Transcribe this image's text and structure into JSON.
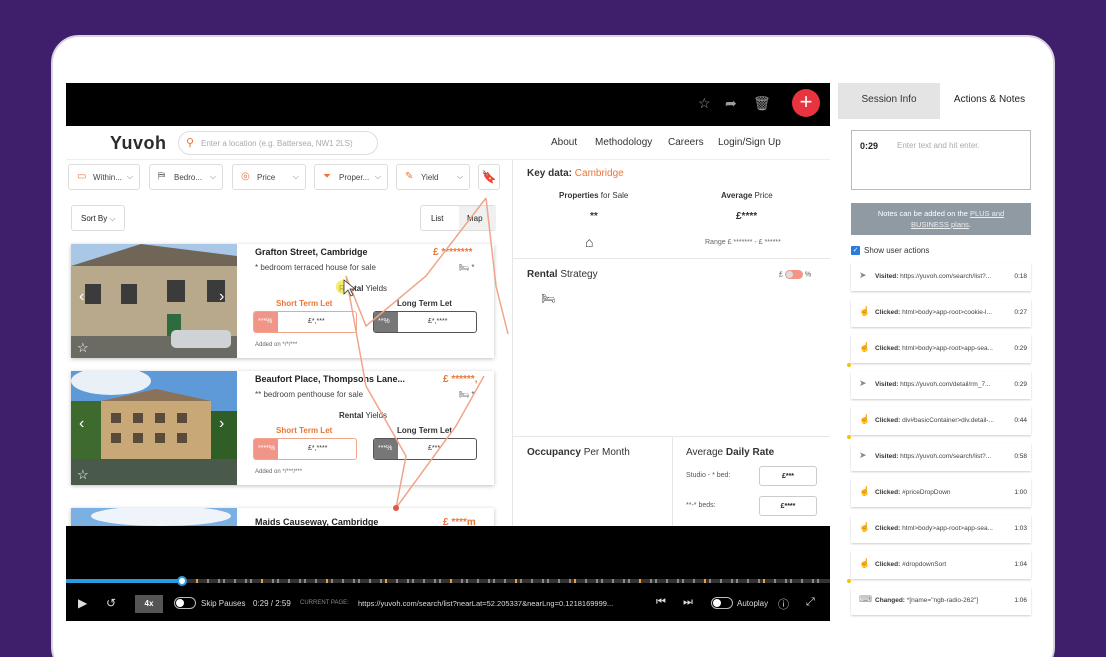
{
  "player": {
    "speed": "4x",
    "skip_pauses_label": "Skip Pauses",
    "time": "0:29 / 2:59",
    "current_page_label": "CURRENT PAGE:",
    "current_page_url": "https://yuvoh.com/search/list?nearLat=52.205337&nearLng=0.1218169999...",
    "autoplay_label": "Autoplay",
    "progress_fraction": 0.152
  },
  "site": {
    "logo": "Yuvoh",
    "search_placeholder": "Enter a location (e.g. Battersea, NW1 2LS)",
    "nav": [
      "About",
      "Methodology",
      "Careers",
      "Login/Sign Up"
    ],
    "filters": [
      "Within...",
      "Bedro...",
      "Price",
      "Proper...",
      "Yield"
    ],
    "sort_label": "Sort By",
    "view_list": "List",
    "view_map": "Map",
    "listings": [
      {
        "title": "Grafton Street, Cambridge",
        "price": "£ ********",
        "beds": "*",
        "desc": "* bedroom terraced house for sale",
        "yields_a": "Rental",
        "yields_b": " Yields",
        "short_label": "Short Term Let",
        "long_label": "Long Term Let",
        "short_pct": "***%",
        "short_val": "£*,***",
        "long_pct": "**%",
        "long_val": "£*,****",
        "added": "Added on */*/***"
      },
      {
        "title": "Beaufort Place, Thompsons Lane...",
        "price": "£ ******,",
        "beds": "*",
        "desc": "** bedroom penthouse for sale",
        "yields_a": "Rental",
        "yields_b": " Yields",
        "short_label": "Short Term Let",
        "long_label": "Long Term Let",
        "short_pct": "****%",
        "short_val": "£*,****",
        "long_pct": "***%",
        "long_val": "£***",
        "added": "Added on */***/***"
      },
      {
        "title": "Maids Causeway, Cambridge",
        "price": "£ ****m"
      }
    ],
    "keydata": {
      "label": "Key data:",
      "city": "Cambridge",
      "props_a": "Properties",
      "props_b": " for Sale",
      "props_val": "**",
      "avg_a": "Average",
      "avg_b": " Price",
      "avg_val": "£****",
      "range": "Range  £ ******* - £ ******"
    },
    "rental": {
      "title_a": "Rental",
      "title_b": " Strategy",
      "cur_left": "£",
      "cur_right": "%"
    },
    "occupancy": {
      "title_a": "Occupancy",
      "title_b": " Per Month"
    },
    "adr": {
      "title_a": "Average ",
      "title_b": "Daily Rate",
      "rows": [
        {
          "label": "Studio - * bed:",
          "value": "£***"
        },
        {
          "label": "**-* beds:",
          "value": "£****"
        }
      ]
    }
  },
  "panel": {
    "tab_session": "Session Info",
    "tab_actions": "Actions & Notes",
    "note_time": "0:29",
    "note_placeholder": "Enter text and hit enter.",
    "locked_text_a": "Notes can be added on the ",
    "locked_link": "PLUS and BUSINESS plans",
    "locked_text_b": ".",
    "show_user_actions": "Show user actions",
    "actions": [
      {
        "icon": "navigate-icon",
        "kind": "Visited:",
        "text": "https://yuvoh.com/search/list?...",
        "time": "0:18"
      },
      {
        "icon": "click-icon",
        "kind": "Clicked:",
        "text": "html>body>app-root>cookie-l...",
        "time": "0:27"
      },
      {
        "icon": "click-icon",
        "kind": "Clicked:",
        "text": "html>body>app-root>app-sea...",
        "time": "0:29"
      },
      {
        "icon": "navigate-icon",
        "kind": "Visited:",
        "text": "https://yuvoh.com/detail/rm_7...",
        "time": "0:29"
      },
      {
        "icon": "click-icon",
        "kind": "Clicked:",
        "text": "div#basicContainer>div.detail-...",
        "time": "0:44"
      },
      {
        "icon": "navigate-icon",
        "kind": "Visited:",
        "text": "https://yuvoh.com/search/list?...",
        "time": "0:58"
      },
      {
        "icon": "click-icon",
        "kind": "Clicked:",
        "text": "#priceDropDown",
        "time": "1:00"
      },
      {
        "icon": "click-icon",
        "kind": "Clicked:",
        "text": "html>body>app-root>app-sea...",
        "time": "1:03"
      },
      {
        "icon": "click-icon",
        "kind": "Clicked:",
        "text": "#dropdownSort",
        "time": "1:04"
      },
      {
        "icon": "keyboard-icon",
        "kind": "Changed:",
        "text": "*[name=\"ngb-radio-262\"]",
        "time": "1:06"
      }
    ]
  },
  "colors": {
    "accent": "#e9763a",
    "brand_bg": "#3f1f6b",
    "fab": "#e8343f",
    "progress": "#2a9be0"
  }
}
